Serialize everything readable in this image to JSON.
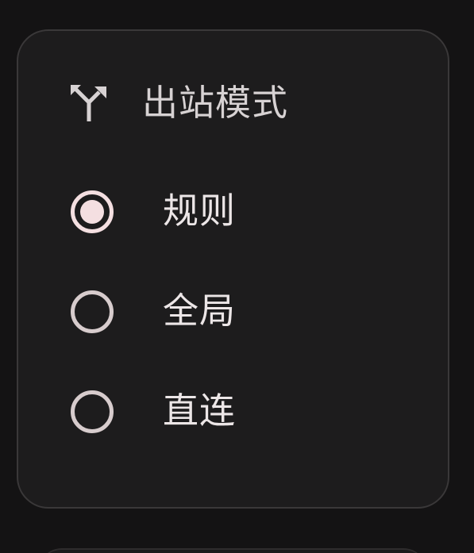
{
  "colors": {
    "background": "#141314",
    "card_background": "#1d1c1d",
    "card_border": "#3a3839",
    "accent": "#f4dfe1",
    "radio_unselected": "#d7cccd",
    "text_primary": "#ece6e7",
    "text_secondary": "#d7d2d3"
  },
  "outbound_mode": {
    "icon": "fork-arrows-icon",
    "title": "出站模式",
    "selected": "规则",
    "options": [
      {
        "label": "规则",
        "checked": true
      },
      {
        "label": "全局",
        "checked": false
      },
      {
        "label": "直连",
        "checked": false
      }
    ]
  }
}
